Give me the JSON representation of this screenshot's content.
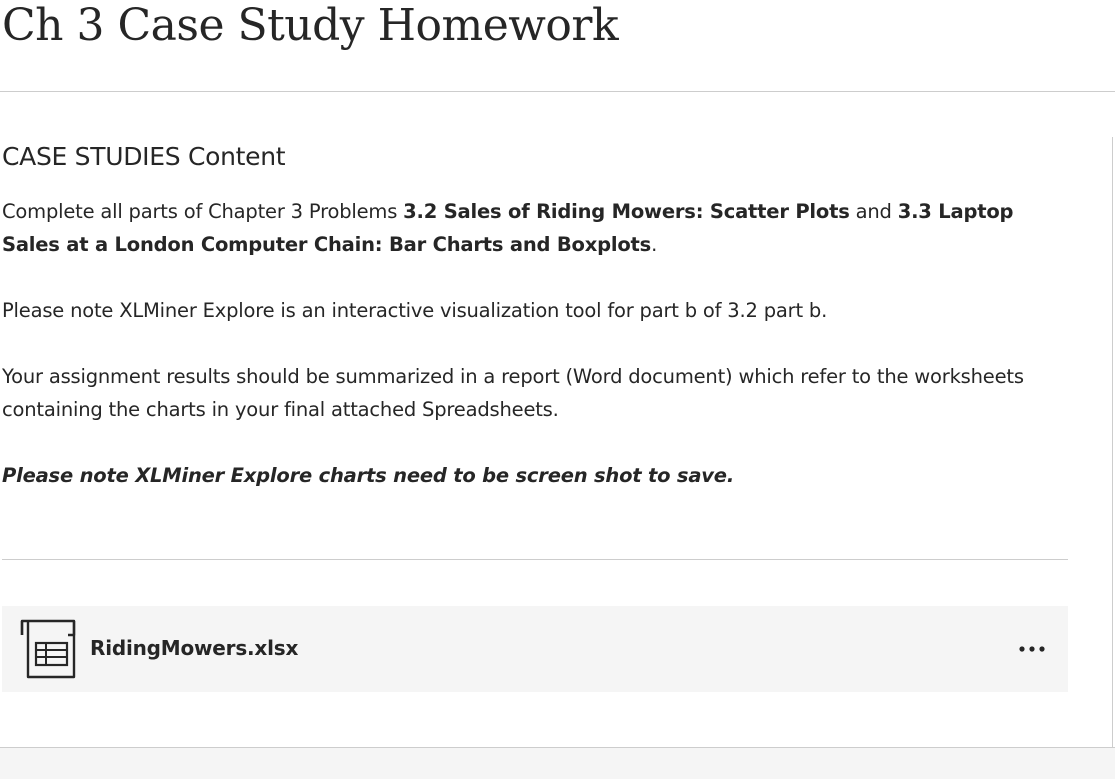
{
  "page": {
    "title": "Ch 3 Case Study Homework"
  },
  "content": {
    "heading": "CASE STUDIES Content",
    "paragraph1": {
      "lead": "Complete all parts of Chapter 3 Problems ",
      "bold1": "3.2 Sales of Riding Mowers: Scatter Plots",
      "mid": " and ",
      "bold2": "3.3 Laptop Sales at a London Computer Chain: Bar Charts and Boxplots",
      "tail": "."
    },
    "paragraph2": "Please note XLMiner Explore is an interactive visualization tool for part b of 3.2 part b.",
    "paragraph3": "Your assignment results should be summarized in a report (Word document) which refer to the worksheets containing the charts in your final attached Spreadsheets.",
    "paragraph4": "Please note XLMiner Explore charts need to be screen shot to save."
  },
  "attachment": {
    "file_name": "RidingMowers.xlsx",
    "icon": "spreadsheet-icon",
    "more_icon": "more-options-icon"
  },
  "colors": {
    "text": "#262626",
    "divider": "#cdcdcd",
    "card_background": "#f5f5f5"
  }
}
